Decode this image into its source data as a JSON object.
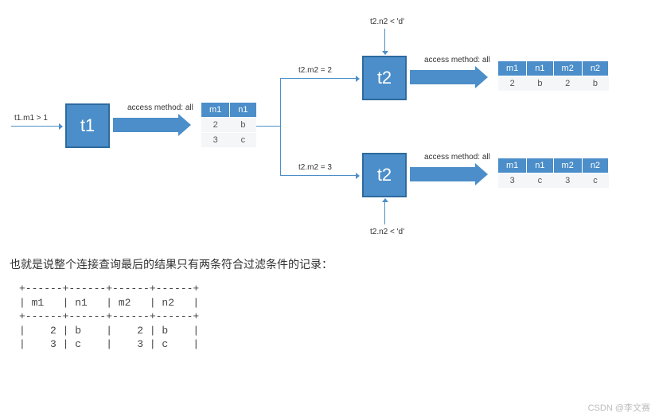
{
  "t1": {
    "label": "t1",
    "filter": "t1.m1 > 1",
    "access": "access method: all",
    "table": {
      "headers": [
        "m1",
        "n1"
      ],
      "rows": [
        [
          "2",
          "b"
        ],
        [
          "3",
          "c"
        ]
      ]
    }
  },
  "branches": {
    "top": {
      "cond_in": "t2.m2 = 2",
      "cond_top": "t2.n2 < 'd'",
      "node": "t2",
      "access": "access method: all",
      "table": {
        "headers": [
          "m1",
          "n1",
          "m2",
          "n2"
        ],
        "rows": [
          [
            "2",
            "b",
            "2",
            "b"
          ]
        ]
      }
    },
    "bottom": {
      "cond_in": "t2.m2 = 3",
      "cond_bot": "t2.n2 < 'd'",
      "node": "t2",
      "access": "access method: all",
      "table": {
        "headers": [
          "m1",
          "n1",
          "m2",
          "n2"
        ],
        "rows": [
          [
            "3",
            "c",
            "3",
            "c"
          ]
        ]
      }
    }
  },
  "caption": "也就是说整个连接查询最后的结果只有两条符合过滤条件的记录：",
  "ascii": {
    "border": "+------+------+------+------+",
    "header": "| m1   | n1   | m2   | n2   |",
    "r1": "|    2 | b    |    2 | b    |",
    "r2": "|    3 | c    |    3 | c    |"
  },
  "watermark": "CSDN @李文赛"
}
